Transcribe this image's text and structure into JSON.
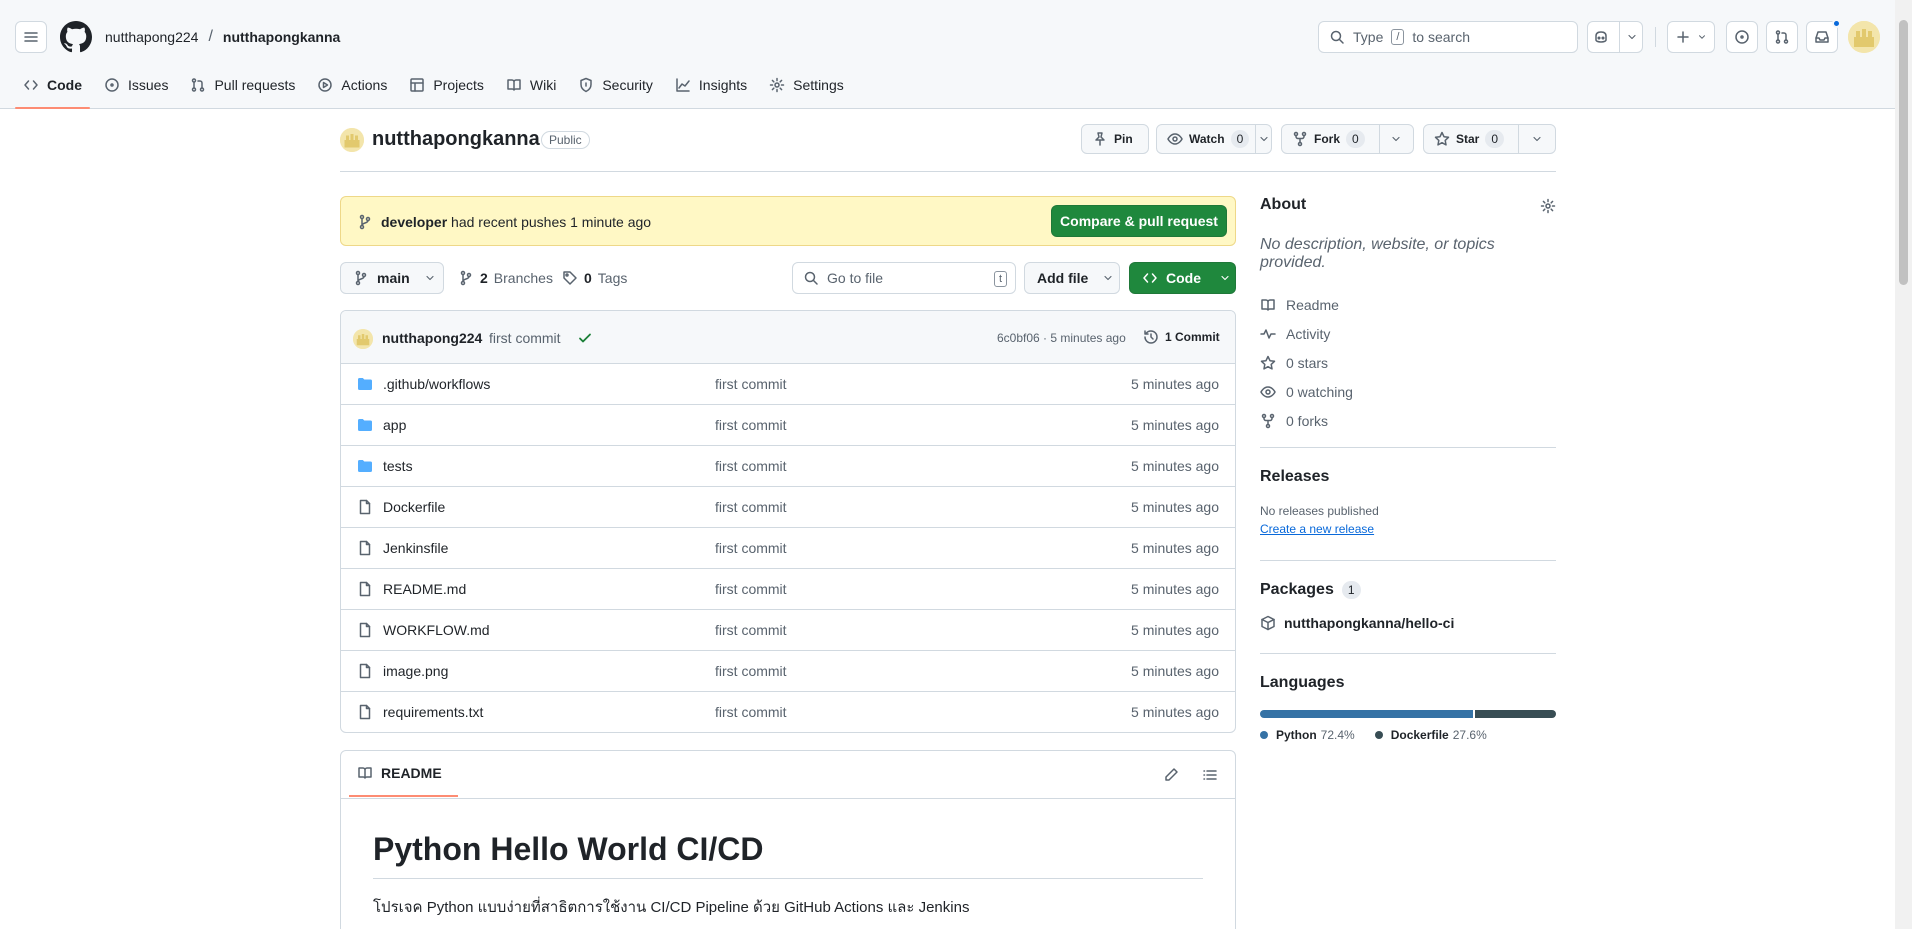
{
  "header": {
    "owner": "nutthapong224",
    "repo": "nutthapongkanna",
    "search_placeholder_left": "Type",
    "search_key": "/",
    "search_placeholder_right": "to search"
  },
  "tabs": [
    {
      "label": "Code",
      "icon": "code-icon"
    },
    {
      "label": "Issues",
      "icon": "issue-icon"
    },
    {
      "label": "Pull requests",
      "icon": "pull-request-icon"
    },
    {
      "label": "Actions",
      "icon": "play-icon"
    },
    {
      "label": "Projects",
      "icon": "table-icon"
    },
    {
      "label": "Wiki",
      "icon": "book-icon"
    },
    {
      "label": "Security",
      "icon": "shield-icon"
    },
    {
      "label": "Insights",
      "icon": "graph-icon"
    },
    {
      "label": "Settings",
      "icon": "gear-icon"
    }
  ],
  "repo": {
    "name": "nutthapongkanna",
    "visibility": "Public",
    "pin": "Pin",
    "watch": "Watch",
    "watch_count": "0",
    "fork": "Fork",
    "fork_count": "0",
    "star": "Star",
    "star_count": "0"
  },
  "banner": {
    "branch": "developer",
    "text": "had recent pushes 1 minute ago",
    "button": "Compare & pull request"
  },
  "branchbar": {
    "branch": "main",
    "branches_count": "2",
    "branches_label": "Branches",
    "tags_count": "0",
    "tags_label": "Tags",
    "goto_placeholder": "Go to file",
    "goto_key": "t",
    "add_file": "Add file",
    "code": "Code"
  },
  "commit": {
    "author": "nutthapong224",
    "message": "first commit",
    "sha_time": "6c0bf06 · 5 minutes ago",
    "commits": "1 Commit"
  },
  "files": [
    {
      "name": ".github/workflows",
      "type": "folder",
      "message": "first commit",
      "time": "5 minutes ago"
    },
    {
      "name": "app",
      "type": "folder",
      "message": "first commit",
      "time": "5 minutes ago"
    },
    {
      "name": "tests",
      "type": "folder",
      "message": "first commit",
      "time": "5 minutes ago"
    },
    {
      "name": "Dockerfile",
      "type": "file",
      "message": "first commit",
      "time": "5 minutes ago"
    },
    {
      "name": "Jenkinsfile",
      "type": "file",
      "message": "first commit",
      "time": "5 minutes ago"
    },
    {
      "name": "README.md",
      "type": "file",
      "message": "first commit",
      "time": "5 minutes ago"
    },
    {
      "name": "WORKFLOW.md",
      "type": "file",
      "message": "first commit",
      "time": "5 minutes ago"
    },
    {
      "name": "image.png",
      "type": "file",
      "message": "first commit",
      "time": "5 minutes ago"
    },
    {
      "name": "requirements.txt",
      "type": "file",
      "message": "first commit",
      "time": "5 minutes ago"
    }
  ],
  "readme": {
    "tab": "README",
    "heading": "Python Hello World CI/CD",
    "paragraph": "โปรเจค Python แบบง่ายที่สาธิตการใช้งาน CI/CD Pipeline ด้วย GitHub Actions และ Jenkins"
  },
  "about": {
    "title": "About",
    "description": "No description, website, or topics provided.",
    "items": [
      {
        "label": "Readme",
        "icon": "book-icon"
      },
      {
        "label": "Activity",
        "icon": "pulse-icon"
      },
      {
        "label": "0 stars",
        "icon": "star-icon"
      },
      {
        "label": "0 watching",
        "icon": "eye-icon"
      },
      {
        "label": "0 forks",
        "icon": "fork-icon"
      }
    ]
  },
  "releases": {
    "title": "Releases",
    "none": "No releases published",
    "create": "Create a new release"
  },
  "packages": {
    "title": "Packages",
    "count": "1",
    "item": "nutthapongkanna/hello-ci"
  },
  "languages": {
    "title": "Languages",
    "items": [
      {
        "name": "Python",
        "percent": "72.4%",
        "value": 72.4,
        "color": "#3572A5"
      },
      {
        "name": "Dockerfile",
        "percent": "27.6%",
        "value": 27.6,
        "color": "#384d54"
      }
    ]
  }
}
